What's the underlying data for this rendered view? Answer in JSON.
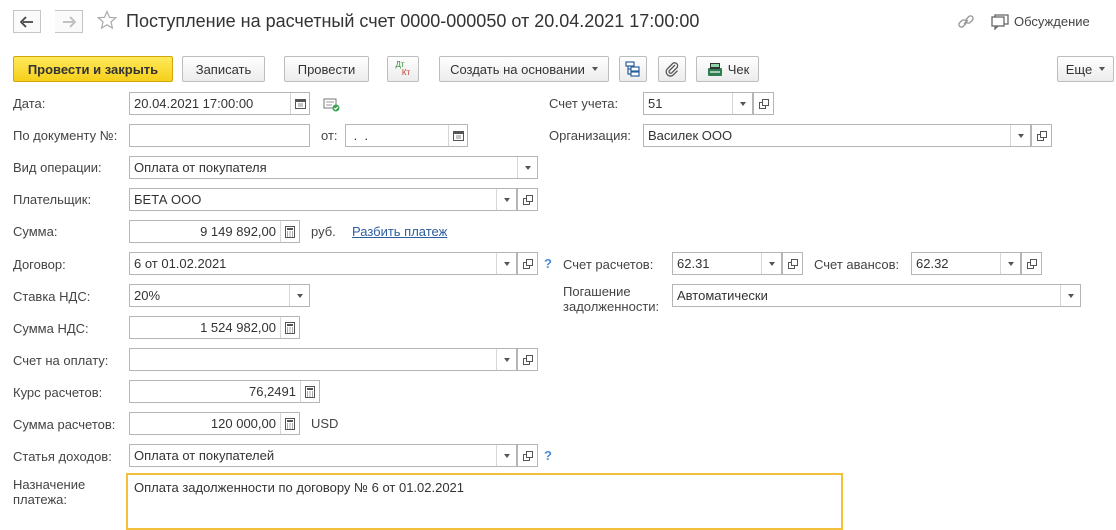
{
  "window": {
    "title": "Поступление на расчетный счет 0000-000050 от 20.04.2021 17:00:00",
    "discussion_label": "Обсуждение"
  },
  "toolbar": {
    "post_and_close": "Провести и закрыть",
    "save": "Записать",
    "post": "Провести",
    "dt_kt_top": "Дт",
    "dt_kt_bottom": "Кт",
    "create_based_on": "Создать на основании",
    "receipt": "Чек",
    "more": "Еще"
  },
  "form": {
    "date": {
      "label": "Дата:",
      "value": "20.04.2021 17:00:00"
    },
    "doc_number": {
      "label": "По документу №:",
      "value": "",
      "from_label": "от:",
      "from_value": " .  ."
    },
    "operation_type": {
      "label": "Вид операции:",
      "value": "Оплата от покупателя"
    },
    "payer": {
      "label": "Плательщик:",
      "value": "БЕТА ООО"
    },
    "amount": {
      "label": "Сумма:",
      "value": "9 149 892,00",
      "currency": "руб.",
      "split_link": "Разбить платеж"
    },
    "contract": {
      "label": "Договор:",
      "value": "6 от 01.02.2021",
      "help": "?"
    },
    "vat_rate": {
      "label": "Ставка НДС:",
      "value": "20%"
    },
    "vat_amount": {
      "label": "Сумма НДС:",
      "value": "1 524 982,00"
    },
    "invoice": {
      "label": "Счет на оплату:",
      "value": ""
    },
    "rate": {
      "label": "Курс расчетов:",
      "value": "76,2491"
    },
    "settlement_amount": {
      "label": "Сумма расчетов:",
      "value": "120 000,00",
      "currency": "USD"
    },
    "income_item": {
      "label": "Статья доходов:",
      "value": "Оплата от покупателей",
      "help": "?"
    },
    "purpose": {
      "label_line1": "Назначение",
      "label_line2": "платежа:",
      "value": "Оплата задолженности по договору № 6 от 01.02.2021"
    },
    "account": {
      "label": "Счет учета:",
      "value": "51"
    },
    "organization": {
      "label": "Организация:",
      "value": "Василек ООО"
    },
    "settlement_account": {
      "label": "Счет расчетов:",
      "value": "62.31"
    },
    "advance_account": {
      "label": "Счет авансов:",
      "value": "62.32"
    },
    "debt_repayment": {
      "label_line1": "Погашение",
      "label_line2": "задолженности:",
      "value": "Автоматически"
    }
  }
}
